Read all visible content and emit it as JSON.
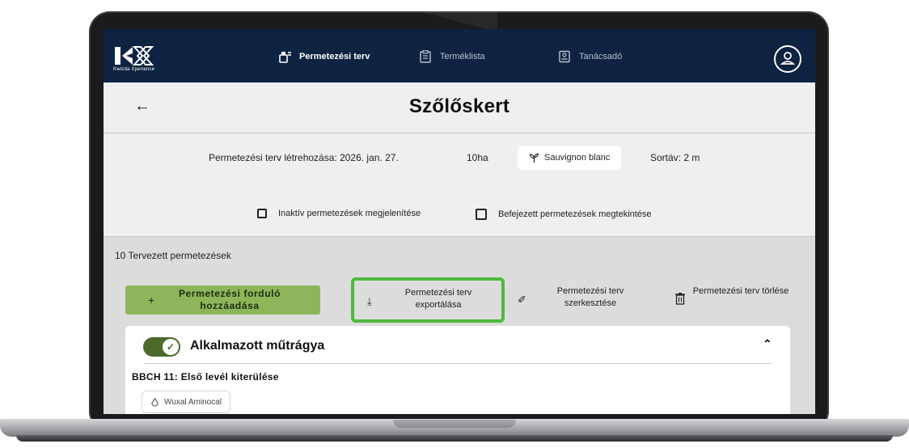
{
  "nav": {
    "logo_text": "Kwizda Xperience",
    "items": [
      {
        "label": "Permetezési terv",
        "icon": "sprayer-icon"
      },
      {
        "label": "Terméklista",
        "icon": "clipboard-list-icon"
      },
      {
        "label": "Tanácsadó",
        "icon": "advisor-icon"
      }
    ],
    "user_icon": "user-icon"
  },
  "header": {
    "title": "Szőlőskert",
    "back_icon": "arrow-left-icon"
  },
  "plan_info": {
    "created": "Permetezési terv létrehozása: 2026. jan. 27.",
    "area": "10ha",
    "variety": "Sauvignon blanc",
    "row_spacing": "Sortáv: 2 m"
  },
  "filters": {
    "inactive_label": "Inaktív permetezések megjelenítése",
    "inactive_checked": false,
    "finished_label": "Befejezett permetezések megtekintése",
    "finished_checked": false
  },
  "planned_count_text": "10 Tervezett permetezések",
  "actions": {
    "add_label": "Permetezési forduló hozzáadása",
    "add_symbol": "+",
    "export_label": "Permetezési terv exportálása",
    "edit_label": "Permetezési terv szerkesztése",
    "delete_label": "Permetezési terv törlése"
  },
  "card": {
    "title": "Alkalmazott műtrágya",
    "toggle_on": true,
    "bbch_title": "BBCH 11: Első levél kiterülése",
    "product_name": "Wuxal Aminocal"
  },
  "colors": {
    "nav_bg": "#0d2341",
    "add_button_bg": "#8db65a",
    "export_highlight": "#4fb83e",
    "toggle_bg": "#4b6a2c"
  }
}
